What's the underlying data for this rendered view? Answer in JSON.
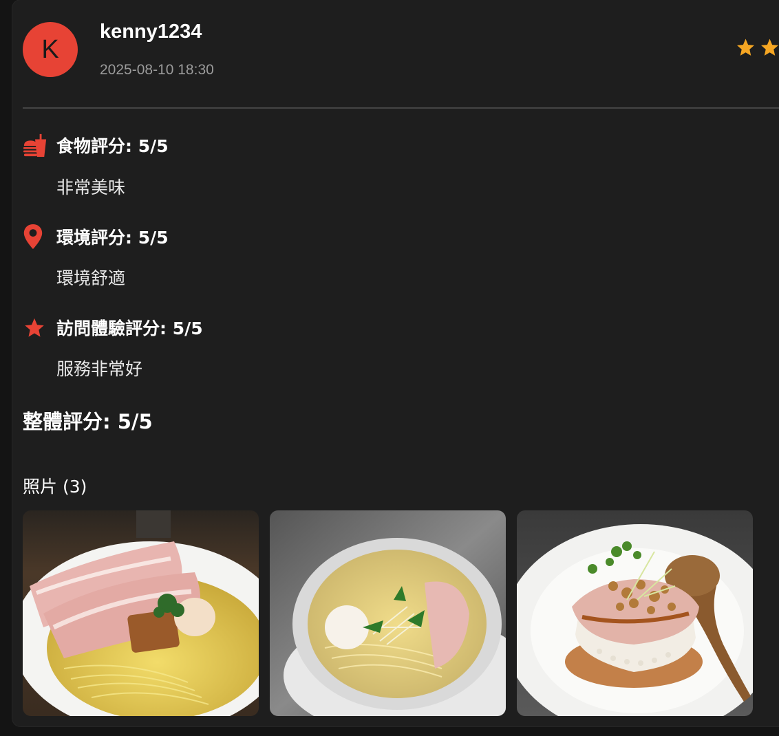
{
  "review": {
    "avatar_initial": "K",
    "username": "kenny1234",
    "timestamp": "2025-08-10 18:30",
    "stars_visible": 2,
    "star_color": "#f5a623"
  },
  "ratings": [
    {
      "icon": "food-icon",
      "title": "食物評分: 5/5",
      "comment": "非常美味"
    },
    {
      "icon": "location-pin-icon",
      "title": "環境評分: 5/5",
      "comment": "環境舒適"
    },
    {
      "icon": "star-icon",
      "title": "訪問體驗評分: 5/5",
      "comment": "服務非常好"
    }
  ],
  "overall": "整體評分: 5/5",
  "photos": {
    "label": "照片 (3)",
    "items": [
      {
        "name": "photo-ramen-chashu"
      },
      {
        "name": "photo-ramen-bowl"
      },
      {
        "name": "photo-chashu-rice"
      }
    ]
  },
  "colors": {
    "accent": "#e74335",
    "background": "#1e1e1e",
    "text_muted": "#9b9b9b"
  }
}
